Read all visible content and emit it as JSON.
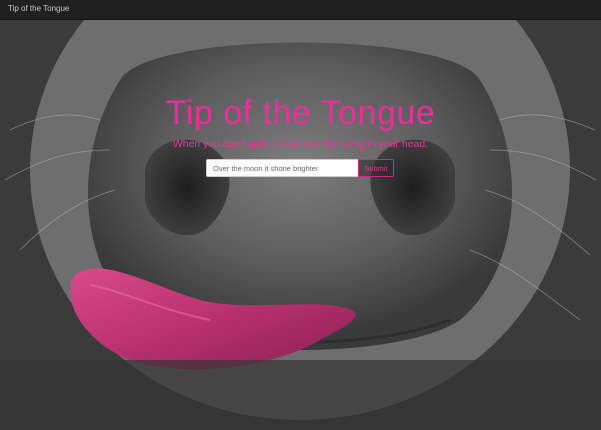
{
  "navbar": {
    "brand": "Tip of the Tongue"
  },
  "hero": {
    "title": "Tip of the Tongue",
    "subtitle": "When you can't quite remember the song in your head.",
    "accent_color": "#ea2f9c",
    "background_description_icon": "cow-nose-tongue-photo"
  },
  "search": {
    "placeholder": "Over the moon it shone brighter",
    "value": "",
    "submit_label": "Submit"
  }
}
